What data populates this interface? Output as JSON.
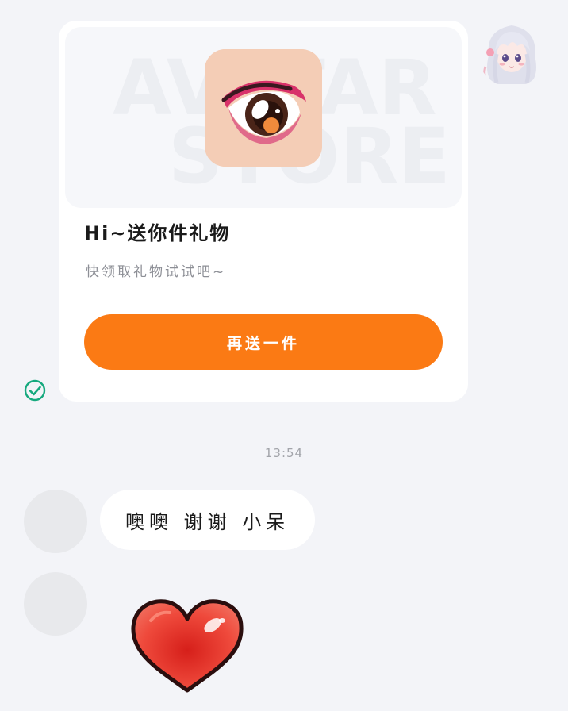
{
  "gift_card": {
    "banner_watermark_line1": "AVATAR",
    "banner_watermark_line2": "STORE",
    "gift_icon": "anime-eye-icon",
    "title": "Hi~送你件礼物",
    "subtitle": "快领取礼物试试吧~",
    "resend_label": "再送一件"
  },
  "read_receipt": {
    "icon": "check-circle-icon",
    "color": "#16a97e"
  },
  "self_avatar": {
    "icon": "anime-girl-avatar"
  },
  "timestamp": "13:54",
  "messages": [
    {
      "type": "text",
      "text": "噢噢 谢谢 小呆"
    },
    {
      "type": "sticker",
      "icon": "red-heart-icon"
    }
  ],
  "colors": {
    "background": "#f3f4f8",
    "accent": "#fb7a14",
    "card": "#ffffff"
  }
}
